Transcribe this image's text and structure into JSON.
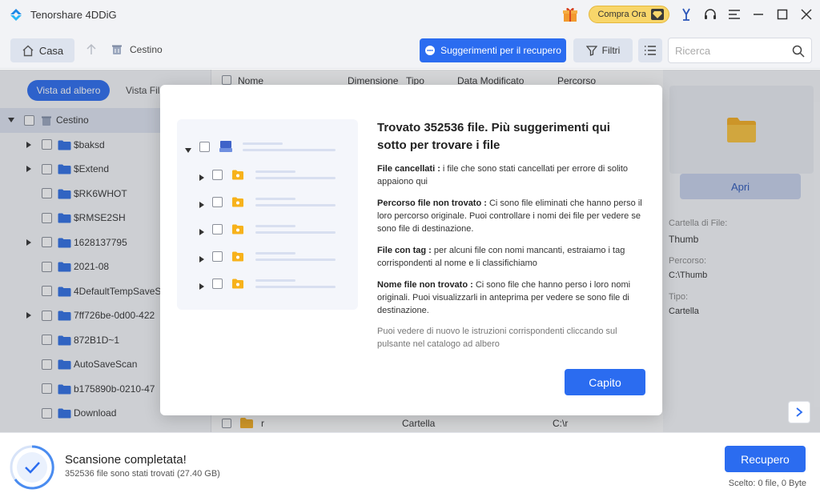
{
  "app": {
    "title": "Tenorshare 4DDiG"
  },
  "titlebar": {
    "buy_label": "Compra Ora"
  },
  "toolbar": {
    "home_label": "Casa",
    "breadcrumb": "Cestino",
    "suggest_label": "Suggerimenti per il recupero",
    "filter_label": "Filtri",
    "search_placeholder": "Ricerca"
  },
  "sidebar": {
    "tab_tree": "Vista ad albero",
    "tab_file": "Vista File",
    "items": [
      {
        "label": "Cestino",
        "arrow": "down",
        "level": 0,
        "selected": true
      },
      {
        "label": "$baksd",
        "arrow": "right",
        "level": 1
      },
      {
        "label": "$Extend",
        "arrow": "right",
        "level": 1
      },
      {
        "label": "$RK6WHOT",
        "arrow": "none",
        "level": 1
      },
      {
        "label": "$RMSE2SH",
        "arrow": "none",
        "level": 1
      },
      {
        "label": "1628137795",
        "arrow": "right",
        "level": 1
      },
      {
        "label": "2021-08",
        "arrow": "none",
        "level": 1
      },
      {
        "label": "4DefaultTempSaveS",
        "arrow": "none",
        "level": 1
      },
      {
        "label": "7ff726be-0d00-422",
        "arrow": "right",
        "level": 1
      },
      {
        "label": "872B1D~1",
        "arrow": "none",
        "level": 1
      },
      {
        "label": "AutoSaveScan",
        "arrow": "none",
        "level": 1
      },
      {
        "label": "b175890b-0210-47",
        "arrow": "none",
        "level": 1
      },
      {
        "label": "Download",
        "arrow": "none",
        "level": 1
      }
    ]
  },
  "list": {
    "headers": {
      "name": "Nome",
      "size": "Dimensione",
      "type": "Tipo",
      "modified": "Data Modificato",
      "path": "Percorso"
    },
    "bottom_row": {
      "name": "r",
      "type": "Cartella",
      "path": "C:\\r"
    }
  },
  "details": {
    "open_label": "Apri",
    "folder_label": "Cartella di File:",
    "folder_value": "Thumb",
    "path_label": "Percorso:",
    "path_value": "C:\\Thumb",
    "type_label": "Tipo:",
    "type_value": "Cartella"
  },
  "modal": {
    "title": "Trovato 352536 file. Più suggerimenti qui sotto per trovare i file",
    "sections": [
      {
        "heading": "File cancellati :",
        "text": " i file che sono stati cancellati per errore di solito appaiono qui"
      },
      {
        "heading": "Percorso file non trovato :",
        "text": " Ci sono file eliminati che hanno perso il loro percorso originale. Puoi controllare i nomi dei file per vedere se sono file di destinazione."
      },
      {
        "heading": "File con tag :",
        "text": " per alcuni file con nomi mancanti, estraiamo i tag corrispondenti al nome e li classifichiamo"
      },
      {
        "heading": "Nome file non trovato :",
        "text": " Ci sono file che hanno perso i loro nomi originali. Puoi visualizzarli in anteprima per vedere se sono file di destinazione."
      }
    ],
    "note": "Puoi vedere di nuovo le istruzioni corrispondenti cliccando sul pulsante nel catalogo ad albero",
    "ok_label": "Capito"
  },
  "status": {
    "title": "Scansione completata!",
    "subtitle": "352536 file sono stati trovati (27.40 GB)",
    "recover_label": "Recupero",
    "selected_info": "Scelto: 0 file, 0 Byte"
  },
  "colors": {
    "accent": "#2b6cf0",
    "folder": "#2f6fe4",
    "icon_orange": "#f7b21b"
  }
}
